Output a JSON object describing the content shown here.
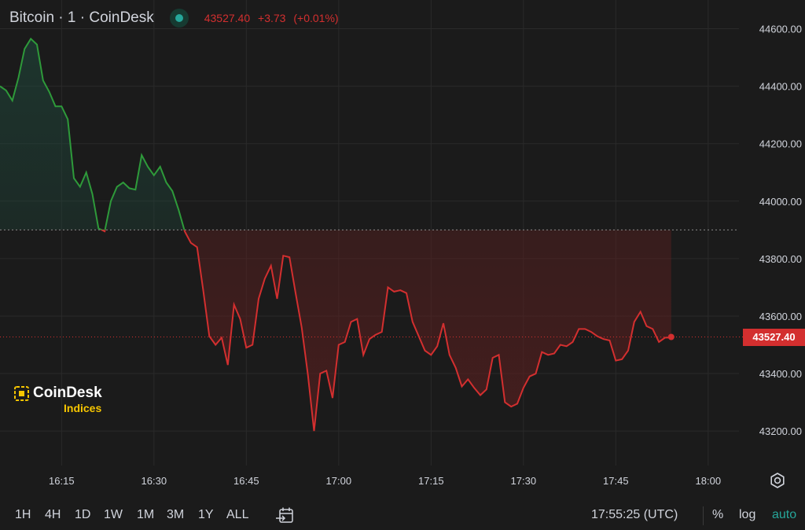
{
  "header": {
    "title": "Bitcoin · 1 · CoinDesk",
    "last": "43527.40",
    "change": "+3.73",
    "change_pct": "(+0.01%)"
  },
  "logo": {
    "word": "CoinDesk",
    "sub": "Indices"
  },
  "price_tag": "43527.40",
  "timeframes": [
    "1H",
    "4H",
    "1D",
    "1W",
    "1M",
    "3M",
    "1Y",
    "ALL"
  ],
  "clock": "17:55:25 (UTC)",
  "options": {
    "percent": "%",
    "log": "log",
    "auto": "auto"
  },
  "colors": {
    "up": "#26a69a",
    "line_up": "#2e9a3a",
    "down": "#d32f2f",
    "background": "#1b1b1b"
  },
  "icons": {
    "calendar": "calendar-goto-icon",
    "settings": "gear-icon"
  },
  "chart_data": {
    "type": "area",
    "baseline": 43900,
    "last_price": 43527.4,
    "ylim": [
      43080,
      44700
    ],
    "xlim": [
      "16:05",
      "18:05"
    ],
    "y_ticks": [
      {
        "v": 44600,
        "label": "44600.00"
      },
      {
        "v": 44400,
        "label": "44400.00"
      },
      {
        "v": 44200,
        "label": "44200.00"
      },
      {
        "v": 44000,
        "label": "44000.00"
      },
      {
        "v": 43800,
        "label": "43800.00"
      },
      {
        "v": 43600,
        "label": "43600.00"
      },
      {
        "v": 43400,
        "label": "43400.00"
      },
      {
        "v": 43200,
        "label": "43200.00"
      }
    ],
    "x_ticks": [
      "16:15",
      "16:30",
      "16:45",
      "17:00",
      "17:15",
      "17:30",
      "17:45",
      "18:00"
    ],
    "grid": true,
    "points": [
      [
        "16:05",
        44400
      ],
      [
        "16:06",
        44385
      ],
      [
        "16:07",
        44350
      ],
      [
        "16:08",
        44430
      ],
      [
        "16:09",
        44530
      ],
      [
        "16:10",
        44565
      ],
      [
        "16:11",
        44545
      ],
      [
        "16:12",
        44420
      ],
      [
        "16:13",
        44380
      ],
      [
        "16:14",
        44330
      ],
      [
        "16:15",
        44330
      ],
      [
        "16:16",
        44285
      ],
      [
        "16:17",
        44080
      ],
      [
        "16:18",
        44050
      ],
      [
        "16:19",
        44100
      ],
      [
        "16:20",
        44025
      ],
      [
        "16:21",
        43905
      ],
      [
        "16:22",
        43895
      ],
      [
        "16:23",
        44000
      ],
      [
        "16:24",
        44050
      ],
      [
        "16:25",
        44065
      ],
      [
        "16:26",
        44045
      ],
      [
        "16:27",
        44040
      ],
      [
        "16:28",
        44160
      ],
      [
        "16:29",
        44120
      ],
      [
        "16:30",
        44090
      ],
      [
        "16:31",
        44120
      ],
      [
        "16:32",
        44065
      ],
      [
        "16:33",
        44035
      ],
      [
        "16:34",
        43970
      ],
      [
        "16:35",
        43895
      ],
      [
        "16:36",
        43855
      ],
      [
        "16:37",
        43840
      ],
      [
        "16:38",
        43690
      ],
      [
        "16:39",
        43530
      ],
      [
        "16:40",
        43500
      ],
      [
        "16:41",
        43525
      ],
      [
        "16:42",
        43430
      ],
      [
        "16:43",
        43640
      ],
      [
        "16:44",
        43590
      ],
      [
        "16:45",
        43490
      ],
      [
        "16:46",
        43500
      ],
      [
        "16:47",
        43660
      ],
      [
        "16:48",
        43730
      ],
      [
        "16:49",
        43775
      ],
      [
        "16:50",
        43660
      ],
      [
        "16:51",
        43810
      ],
      [
        "16:52",
        43805
      ],
      [
        "16:53",
        43680
      ],
      [
        "16:54",
        43560
      ],
      [
        "16:55",
        43395
      ],
      [
        "16:56",
        43200
      ],
      [
        "16:57",
        43400
      ],
      [
        "16:58",
        43410
      ],
      [
        "16:59",
        43315
      ],
      [
        "17:00",
        43500
      ],
      [
        "17:01",
        43510
      ],
      [
        "17:02",
        43580
      ],
      [
        "17:03",
        43590
      ],
      [
        "17:04",
        43465
      ],
      [
        "17:05",
        43520
      ],
      [
        "17:06",
        43535
      ],
      [
        "17:07",
        43545
      ],
      [
        "17:08",
        43700
      ],
      [
        "17:09",
        43685
      ],
      [
        "17:10",
        43690
      ],
      [
        "17:11",
        43680
      ],
      [
        "17:12",
        43580
      ],
      [
        "17:13",
        43530
      ],
      [
        "17:14",
        43480
      ],
      [
        "17:15",
        43465
      ],
      [
        "17:16",
        43495
      ],
      [
        "17:17",
        43575
      ],
      [
        "17:18",
        43465
      ],
      [
        "17:19",
        43420
      ],
      [
        "17:20",
        43355
      ],
      [
        "17:21",
        43380
      ],
      [
        "17:22",
        43350
      ],
      [
        "17:23",
        43325
      ],
      [
        "17:24",
        43345
      ],
      [
        "17:25",
        43455
      ],
      [
        "17:26",
        43465
      ],
      [
        "17:27",
        43300
      ],
      [
        "17:28",
        43285
      ],
      [
        "17:29",
        43295
      ],
      [
        "17:30",
        43350
      ],
      [
        "17:31",
        43390
      ],
      [
        "17:32",
        43400
      ],
      [
        "17:33",
        43475
      ],
      [
        "17:34",
        43465
      ],
      [
        "17:35",
        43470
      ],
      [
        "17:36",
        43500
      ],
      [
        "17:37",
        43495
      ],
      [
        "17:38",
        43510
      ],
      [
        "17:39",
        43555
      ],
      [
        "17:40",
        43555
      ],
      [
        "17:41",
        43545
      ],
      [
        "17:42",
        43530
      ],
      [
        "17:43",
        43520
      ],
      [
        "17:44",
        43515
      ],
      [
        "17:45",
        43445
      ],
      [
        "17:46",
        43450
      ],
      [
        "17:47",
        43480
      ],
      [
        "17:48",
        43580
      ],
      [
        "17:49",
        43615
      ],
      [
        "17:50",
        43565
      ],
      [
        "17:51",
        43555
      ],
      [
        "17:52",
        43510
      ],
      [
        "17:53",
        43525
      ],
      [
        "17:54",
        43525
      ]
    ]
  }
}
